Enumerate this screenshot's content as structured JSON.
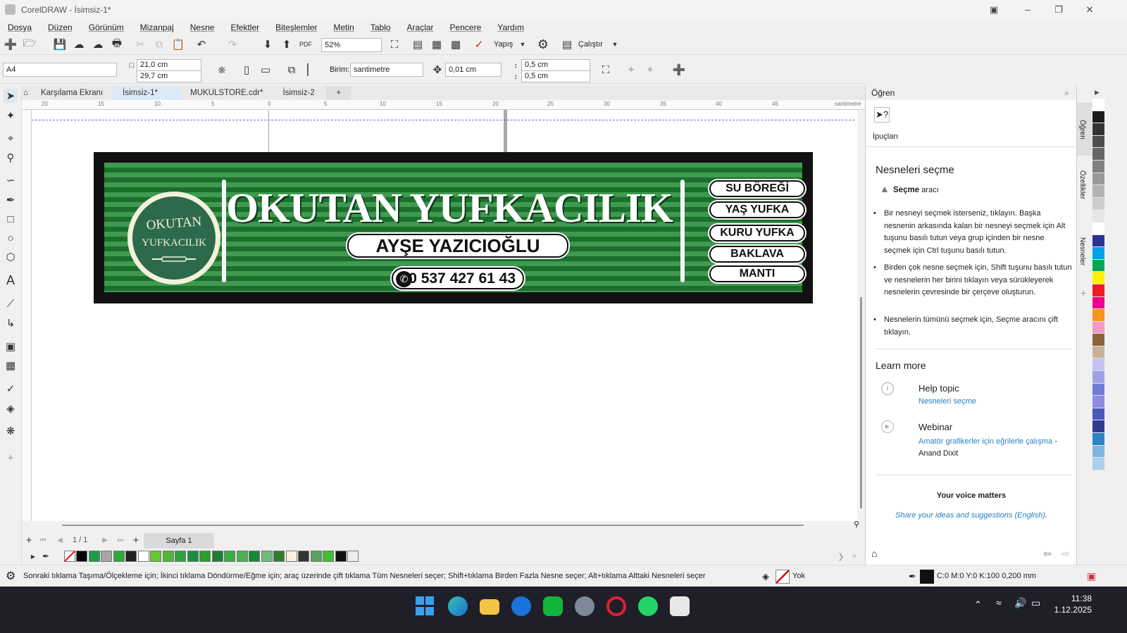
{
  "window": {
    "title": "CorelDRAW - İsimsiz-1*"
  },
  "menu": [
    "Dosya",
    "Düzen",
    "Görünüm",
    "Mizanpaj",
    "Nesne",
    "Efektler",
    "Biteşlemler",
    "Metin",
    "Tablo",
    "Araçlar",
    "Pencere",
    "Yardım"
  ],
  "toolbar": {
    "zoom": "52%",
    "snap_label": "Yapış",
    "run_label": "Çalıştır",
    "pdf_label": "PDF"
  },
  "propertybar": {
    "page_size": "A4",
    "width": "21,0 cm",
    "height": "29,7 cm",
    "unit_label": "Birim:",
    "unit_value": "santimetre",
    "nudge": "0,01 cm",
    "dup_x": "0,5 cm",
    "dup_y": "0,5 cm"
  },
  "tabs": [
    {
      "label": "Karşılama Ekranı"
    },
    {
      "label": "İsimsiz-1*"
    },
    {
      "label": "MUKULSTORE.cdr*"
    },
    {
      "label": "İsimsiz-2"
    }
  ],
  "ruler": {
    "unit": "santimetre",
    "ticks": [
      "20",
      "15",
      "10",
      "5",
      "0",
      "5",
      "10",
      "15",
      "20",
      "25",
      "30",
      "35",
      "40",
      "45"
    ]
  },
  "design": {
    "business_name": "OKUTAN YUFKACILIK",
    "logo_line1": "OKUTAN",
    "logo_line2": "YUFKACILIK",
    "owner": "AYŞE YAZICIOĞLU",
    "phone": "0 537 427 61 43",
    "products": [
      "SU BÖREĞİ",
      "YAŞ YUFKA",
      "KURU YUFKA",
      "BAKLAVA",
      "MANTI"
    ],
    "colors": {
      "frame": "#111111",
      "stripe_light": "#3f9a50",
      "stripe_dark": "#1b6e2c",
      "logo": "#2c6a4b"
    }
  },
  "pagenav": {
    "counter": "1 / 1",
    "page_tab": "Sayfa 1"
  },
  "palette": [
    "#000000",
    "#1a9e4a",
    "#a6a6a6",
    "#2faa3a",
    "#222222",
    "#ffffff",
    "#64c832",
    "#4fb83a",
    "#30a040",
    "#1e8c3c",
    "#2c9c2c",
    "#1e7d35",
    "#38ab43",
    "#4caf50",
    "#138a36",
    "#6fba7c",
    "#2e7d32",
    "#f5f1dc",
    "#333333",
    "#58a05f",
    "#40bf30",
    "#111111",
    "#eeeeee"
  ],
  "learn_panel": {
    "header": "Öğren",
    "tips_label": "İpuçları",
    "heading": "Nesneleri seçme",
    "tool_bold": "Seçme",
    "tool_rest": "aracı",
    "bullets": [
      "Bir nesneyi seçmek isterseniz, tıklayın. Başka nesnenin arkasında kalan bir nesneyi seçmek için Alt tuşunu basılı tutun veya grup içinden bir nesne seçmek için Ctrl tuşunu basılı tutun.",
      "Birden çok nesne seçmek için, Shift tuşunu basılı tutun ve nesnelerin her birini tıklayın veya sürükleyerek nesnelerin çevresinde bir çerçeve oluşturun.",
      "Nesnelerin tümünü seçmek için, Seçme aracını çift tıklayın."
    ],
    "learn_more": "Learn more",
    "help_topic_label": "Help topic",
    "help_topic_link": "Nesneleri seçme",
    "webinar_label": "Webinar",
    "webinar_link": "Amatör grafikerler için eğrilerle çalışma",
    "webinar_author": "- Anand Dixit",
    "voice_title": "Your voice matters",
    "voice_link": "Share your ideas and suggestions (English)."
  },
  "docker_tabs": [
    "Öğren",
    "Özellikler",
    "Nesneler"
  ],
  "color_strip": [
    "#ffffff",
    "#1a1a1a",
    "#333333",
    "#4d4d4d",
    "#666666",
    "#808080",
    "#999999",
    "#b3b3b3",
    "#cccccc",
    "#e6e6e6",
    "#ffffff",
    "#2e3192",
    "#00a0e9",
    "#00a651",
    "#fff200",
    "#ed1c24",
    "#ec008c",
    "#f7941d",
    "#f49ac1",
    "#8c6239",
    "#c7b299",
    "#c4c3f0",
    "#a0a0e8",
    "#6f7dd8",
    "#8c8ce0",
    "#4a5ab8",
    "#2f3c90",
    "#2a84c8",
    "#7bb8e0",
    "#a9d0ec"
  ],
  "status": {
    "message": "Sonraki tıklama Taşıma/Ölçekleme için; İkinci tıklama Döndürme/Eğme için; araç üzerinde çift tıklama Tüm Nesneleri seçer; Shift+tıklama Birden Fazla Nesne seçer; Alt+tıklama Alttaki Nesneleri seçer",
    "fill": "Yok",
    "outline": "C:0 M:0 Y:0 K:100  0,200 mm"
  },
  "clock": {
    "time": "11:38",
    "date": "1.12.2025"
  }
}
